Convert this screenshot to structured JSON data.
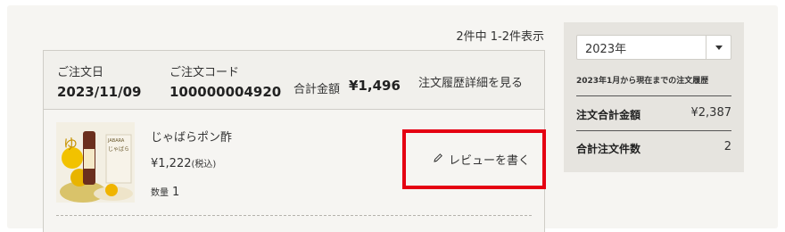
{
  "result_count": "2件中 1-2件表示",
  "order": {
    "date_label": "ご注文日",
    "date": "2023/11/09",
    "code_label": "ご注文コード",
    "code": "100000004920",
    "total_label": "合計金額",
    "total": "¥1,496",
    "detail_link": "注文履歴詳細を見る",
    "item": {
      "name": "じゃばらポン酢",
      "price": "¥1,222",
      "tax_note": "(税込)",
      "qty_label": "数量",
      "qty": "1",
      "image_text": "じゃばら"
    },
    "review_label": "レビューを書く",
    "review_icon": "pencil-icon"
  },
  "sidebar": {
    "year_selected": "2023年",
    "caption": "2023年1月から現在までの注文履歴",
    "stats": [
      {
        "label": "注文合計金額",
        "value": "¥2,387"
      },
      {
        "label": "合計注文件数",
        "value": "2"
      }
    ]
  },
  "colors": {
    "highlight": "#e50012",
    "panel_bg": "#f6f5f2",
    "sidebar_bg": "#e6e4df"
  }
}
